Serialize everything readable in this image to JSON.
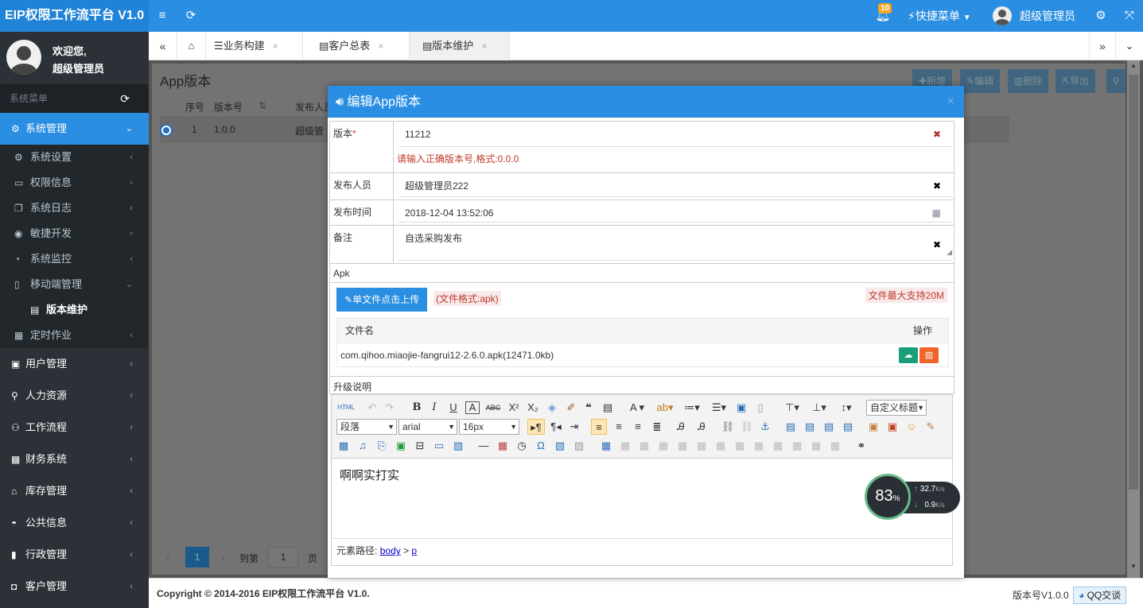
{
  "app": {
    "title": "EIP权限工作流平台 V1.0"
  },
  "topbar": {
    "notify_count": "10",
    "quick_menu": "快捷菜单",
    "user_name": "超级管理员"
  },
  "sidebar": {
    "welcome": "欢迎您,",
    "user": "超级管理员",
    "menu_header": "系统菜单",
    "sections": [
      {
        "label": "系统管理"
      },
      {
        "label": "用户管理"
      },
      {
        "label": "人力资源"
      },
      {
        "label": "工作流程"
      },
      {
        "label": "财务系统"
      },
      {
        "label": "库存管理"
      },
      {
        "label": "公共信息"
      },
      {
        "label": "行政管理"
      },
      {
        "label": "客户管理"
      }
    ],
    "sub_items": [
      {
        "label": "系统设置"
      },
      {
        "label": "权限信息"
      },
      {
        "label": "系统日志"
      },
      {
        "label": "敏捷开发"
      },
      {
        "label": "系统监控"
      },
      {
        "label": "移动端管理"
      },
      {
        "label": "版本维护"
      },
      {
        "label": "定时作业"
      }
    ]
  },
  "tabs": [
    {
      "label": "业务构建"
    },
    {
      "label": "客户总表"
    },
    {
      "label": "版本维护"
    }
  ],
  "page": {
    "title": "App版本",
    "toolbar": {
      "add": "新增",
      "edit": "编辑",
      "delete": "删除",
      "export": "导出"
    },
    "table": {
      "headers": [
        "序号",
        "版本号",
        "发布人员"
      ],
      "rows": [
        {
          "index": "1",
          "version": "1.0.0",
          "publisher": "超级管"
        }
      ]
    },
    "pager": {
      "current": "1",
      "goto": "到第",
      "input": "1",
      "page_suffix": "页"
    }
  },
  "modal": {
    "title": "编辑App版本",
    "fields": {
      "version_label": "版本",
      "version_required": "*",
      "version_value": "11212",
      "version_error": "请输入正确版本号,格式:0.0.0",
      "publisher_label": "发布人员",
      "publisher_value": "超级管理员222",
      "time_label": "发布时间",
      "time_value": "2018-12-04 13:52:06",
      "remark_label": "备注",
      "remark_value": "自选采购发布",
      "apk_label": "Apk"
    },
    "upload": {
      "button": "单文件点击上传",
      "format_hint": "(文件格式:apk)",
      "size_hint": "文件最大支持20M",
      "col_name": "文件名",
      "col_op": "操作",
      "file_name": "com.qihoo.miaojie-fangrui12-2.6.0.apk(12471.0kb)"
    },
    "notes_label": "升级说明",
    "editor": {
      "html_btn": "HTML",
      "custom_title": "自定义标题",
      "paragraph": "段落",
      "font": "arial",
      "size": "16px",
      "content": "啊啊实打实",
      "path_label": "元素路径:",
      "path_body": "body",
      "path_sep": ">",
      "path_p": "p"
    }
  },
  "speed_widget": {
    "percent": "83",
    "percent_sign": "%",
    "up": "32.7",
    "down": "0.9",
    "unit": "K/s"
  },
  "footer": {
    "copyright": "Copyright © 2014-2016 EIP权限工作流平台 V1.0.",
    "version": "版本号V1.0.0",
    "qq": "QQ交谈"
  },
  "colors": {
    "primary": "#2a8ee2",
    "sidebar": "#2b3137",
    "error": "#c0392b"
  }
}
